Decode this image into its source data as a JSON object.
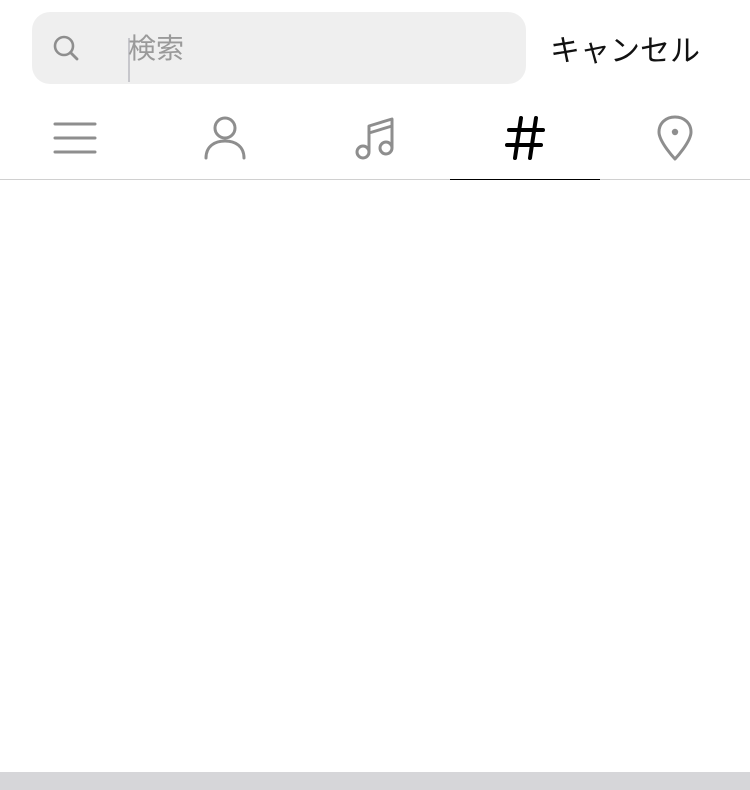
{
  "search": {
    "placeholder": "検索",
    "value": "",
    "cancel_label": "キャンセル"
  },
  "tabs": [
    {
      "name": "top",
      "icon": "menu-icon",
      "active": false
    },
    {
      "name": "accounts",
      "icon": "person-icon",
      "active": false
    },
    {
      "name": "audio",
      "icon": "music-note-icon",
      "active": false
    },
    {
      "name": "tags",
      "icon": "hashtag-icon",
      "active": true
    },
    {
      "name": "places",
      "icon": "location-pin-icon",
      "active": false
    }
  ],
  "colors": {
    "icon_inactive": "#8e8e8e",
    "icon_active": "#000000",
    "search_bg": "#efefef",
    "divider": "#d0d0d0"
  }
}
